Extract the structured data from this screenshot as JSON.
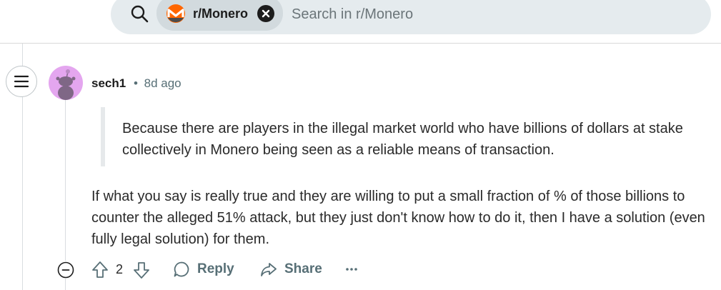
{
  "search": {
    "community": "r/Monero",
    "placeholder": "Search in r/Monero"
  },
  "comment": {
    "author": "sech1",
    "separator": "•",
    "time": "8d ago",
    "quote": "Because there are players in the illegal market world who have billions of dollars at stake collectively in Monero being seen as a reliable means of transaction.",
    "body": "If what you say is really true and they are willing to put a small fraction of % of those billions to counter the alleged 51% attack, but they just don't know how to do it, then I have a solution (even fully legal solution) for them.",
    "score": "2"
  },
  "actions": {
    "reply": "Reply",
    "share": "Share"
  },
  "icons": {
    "search": "search-icon",
    "community": "monero-logo",
    "clear": "close-icon",
    "menu": "hamburger-icon",
    "avatar": "snoo-avatar",
    "collapse": "minus-circle-icon",
    "upvote": "arrow-up-icon",
    "downvote": "arrow-down-icon",
    "reply": "speech-bubble-icon",
    "share": "share-arrow-icon",
    "more": "ellipsis-icon"
  },
  "colors": {
    "search_bg": "#e5ebee",
    "chip_bg": "#d2dade",
    "monero_orange": "#ff6600",
    "avatar_bg": "#e4a6ef",
    "meta_gray": "#576f76"
  }
}
